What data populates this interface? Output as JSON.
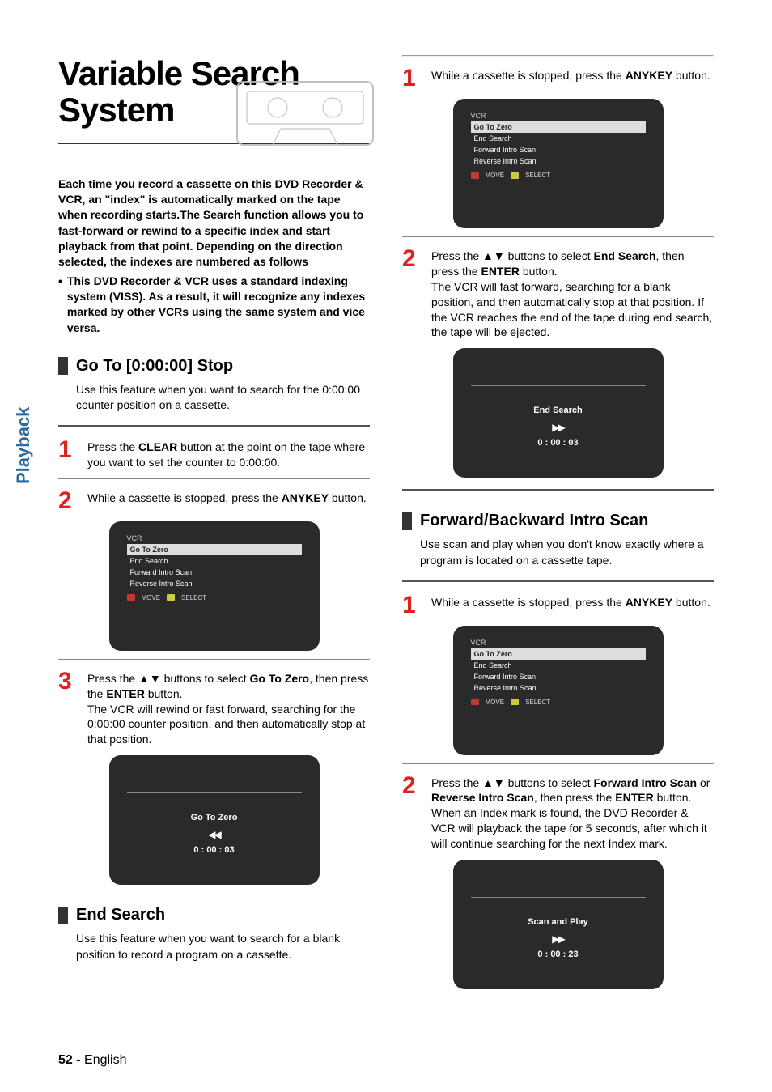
{
  "page": {
    "title_l1": "Variable Search",
    "title_l2": "System",
    "intro_p1": "Each time you record a cassette on this DVD Recorder & VCR, an \"index\" is automatically marked on the tape when recording starts.The Search function allows you to fast-forward or rewind to a specific index and start playback from that point. Depending on the direction selected, the indexes are numbered as follows",
    "intro_bullet": "This DVD Recorder & VCR uses a standard indexing system (VISS). As a result, it will recognize any indexes marked by other VCRs using the same system and vice versa.",
    "footer_page": "52 - ",
    "footer_lang": "English"
  },
  "osd_menu": {
    "title": "VCR",
    "items": [
      "Go To Zero",
      "End Search",
      "Forward Intro Scan",
      "Reverse Intro Scan"
    ],
    "legend_move": "MOVE",
    "legend_select": "SELECT"
  },
  "sec_goto": {
    "heading": "Go To [0:00:00] Stop",
    "sub": "Use this feature when you want to search for the 0:00:00 counter position on a cassette.",
    "step1_a": "Press the ",
    "step1_b": "CLEAR",
    "step1_c": " button at the point on the tape where you want to set the counter to 0:00:00.",
    "step2_a": "While a cassette is stopped, press the ",
    "step2_b": "ANYKEY",
    "step2_c": " button.",
    "step3_a": "Press the ▲▼ buttons to select ",
    "step3_b": "Go To Zero",
    "step3_c": ", then press the ",
    "step3_d": "ENTER",
    "step3_e": " button.",
    "step3_f": "The VCR will rewind or fast forward, searching for the 0:00:00 counter position, and then automatically stop at that position.",
    "osd_label": "Go To Zero",
    "osd_sym": "◀◀",
    "osd_time": "0 : 00 : 03"
  },
  "sec_end": {
    "heading": "End Search",
    "sub": "Use this feature when you want to search for a blank position to record a program on a cassette.",
    "step1_a": "While a cassette is stopped, press the ",
    "step1_b": "ANYKEY",
    "step1_c": " button.",
    "step2_a": "Press the ▲▼ buttons to select ",
    "step2_b": "End Search",
    "step2_c": ", then press the ",
    "step2_d": "ENTER",
    "step2_e": " button.",
    "step2_f": "The VCR will fast forward, searching for a blank position, and then automatically stop at that position. If the VCR reaches the end of the tape during end search, the tape will be ejected.",
    "osd_label": "End Search",
    "osd_sym": "▶▶",
    "osd_time": "0 : 00 : 03"
  },
  "sec_scan": {
    "heading": "Forward/Backward Intro Scan",
    "sub": "Use scan and play when you don't know exactly where a program is located on a cassette tape.",
    "step1_a": "While a cassette is stopped, press the ",
    "step1_b": "ANYKEY",
    "step1_c": " button.",
    "step2_a": "Press the ▲▼ buttons to select ",
    "step2_b": "Forward Intro Scan",
    "step2_c": " or ",
    "step2_d": "Reverse Intro Scan",
    "step2_e": ", then press the ",
    "step2_f": "ENTER",
    "step2_g": " button. When an Index mark is found, the DVD Recorder & VCR will playback the tape for 5 seconds, after which it will continue searching for the next Index mark.",
    "osd_label": "Scan and Play",
    "osd_sym": "▶▶",
    "osd_time": "0 : 00 : 23"
  },
  "sidetab": "Playback"
}
